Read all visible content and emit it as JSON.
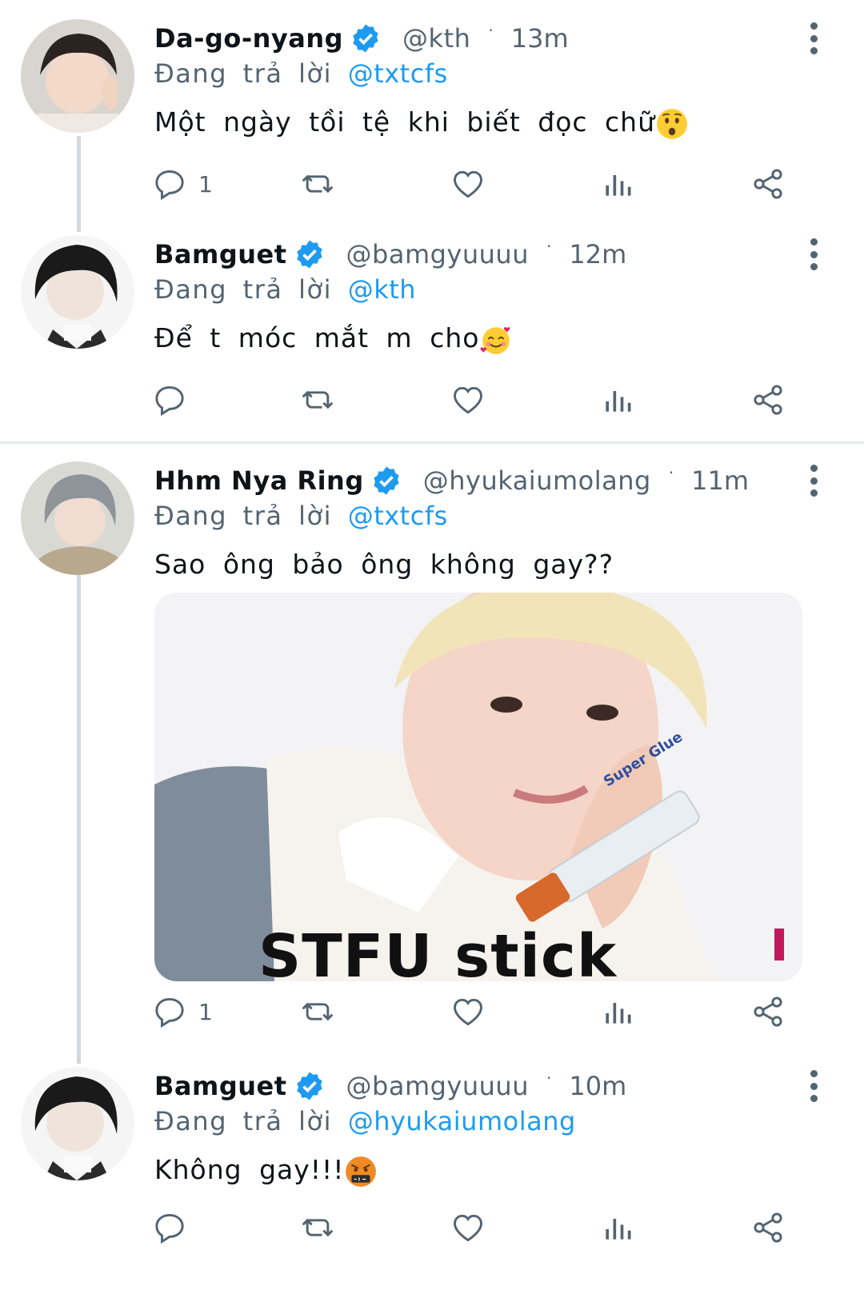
{
  "reply_prefix": "Đang trả lời",
  "tweets": [
    {
      "name": "Da-go-nyang",
      "handle": "@kth",
      "time": "13m",
      "reply_to": "@txtcfs",
      "text": "Một ngày tồi tệ khi biết đọc chữ",
      "emoji": "worried-face",
      "reply_count": "1"
    },
    {
      "name": "Bamguet",
      "handle": "@bamgyuuuu",
      "time": "12m",
      "reply_to": "@kth",
      "text": "Để t móc mắt m cho",
      "emoji": "smiling-face-with-hearts",
      "reply_count": ""
    },
    {
      "name": "Hhm Nya Ring",
      "handle": "@hyukaiumolang",
      "time": "11m",
      "reply_to": "@txtcfs",
      "text": "Sao ông bảo ông không gay??",
      "media_caption": "STFU stick",
      "media_label": "Super Glue",
      "reply_count": "1"
    },
    {
      "name": "Bamguet",
      "handle": "@bamgyuuuu",
      "time": "10m",
      "reply_to": "@hyukaiumolang",
      "text": "Không gay!!!",
      "emoji": "face-with-symbols-on-mouth",
      "reply_count": ""
    }
  ],
  "colors": {
    "accent": "#1d9bf0",
    "muted": "#536471",
    "thread": "#cfd9de"
  }
}
